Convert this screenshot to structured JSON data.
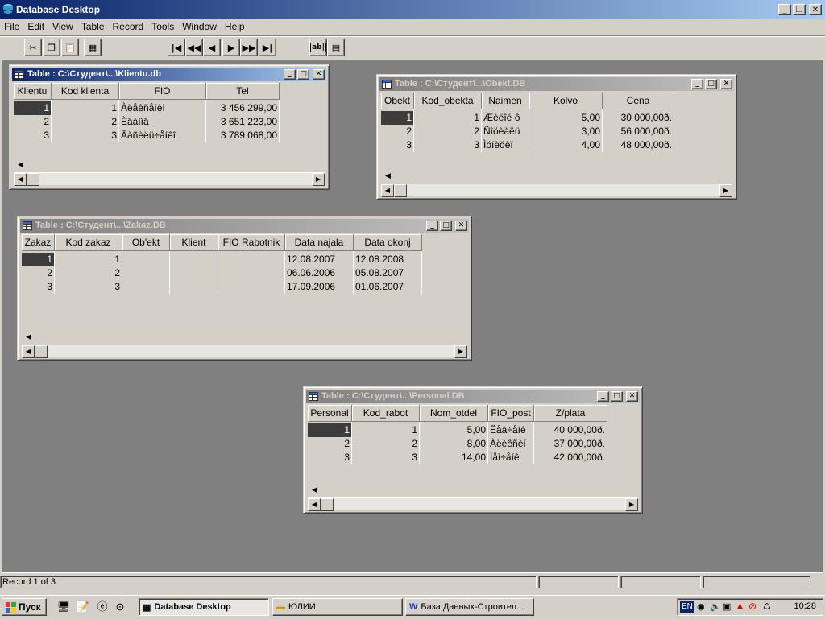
{
  "app": {
    "title": "Database Desktop"
  },
  "menu": [
    "File",
    "Edit",
    "View",
    "Table",
    "Record",
    "Tools",
    "Window",
    "Help"
  ],
  "toolbar": {
    "buttons": [
      "cut",
      "copy",
      "paste",
      "print",
      "first-record",
      "prev-set",
      "prev-record",
      "next-record",
      "next-set",
      "last-record",
      "edit-data",
      "restructure"
    ],
    "edit_label": "ab|"
  },
  "windows": {
    "klientu": {
      "title": "Table : C:\\Студент\\...\\Klientu.db",
      "columns": [
        "Klientu",
        "Kod klienta",
        "FIO",
        "Tel"
      ],
      "rows": [
        [
          "1",
          "1",
          "Àëåêñåíêî",
          "3 456 299,00"
        ],
        [
          "2",
          "2",
          "Èâàíîâ",
          "3 651 223,00"
        ],
        [
          "3",
          "3",
          "Âàñèëü÷åíêî",
          "3 789 068,00"
        ]
      ]
    },
    "obekt": {
      "title": "Table : C:\\Студент\\...\\Obekt.DB",
      "columns": [
        "Obekt",
        "Kod_obekta",
        "Naimen",
        "Kolvo",
        "Cena"
      ],
      "rows": [
        [
          "1",
          "1",
          "Æèëîé ô",
          "5,00",
          "30 000,00ð."
        ],
        [
          "2",
          "2",
          "Ñîöèàëü",
          "3,00",
          "56 000,00ð."
        ],
        [
          "3",
          "3",
          "Ìóíèöèï",
          "4,00",
          "48 000,00ð."
        ]
      ]
    },
    "zakaz": {
      "title": "Table : C:\\Студент\\...\\Zakaz.DB",
      "columns": [
        "Zakaz",
        "Kod zakaz",
        "Ob'ekt",
        "Klient",
        "FIO Rabotnik",
        "Data najala",
        "Data okonj"
      ],
      "rows": [
        [
          "1",
          "1",
          "",
          "",
          "",
          "12.08.2007",
          "12.08.2008"
        ],
        [
          "2",
          "2",
          "",
          "",
          "",
          "06.06.2006",
          "05.08.2007"
        ],
        [
          "3",
          "3",
          "",
          "",
          "",
          "17.09.2006",
          "01.06.2007"
        ]
      ]
    },
    "personal": {
      "title": "Table : C:\\Студент\\...\\Personal.DB",
      "columns": [
        "Personal",
        "Kod_rabot",
        "Nom_otdel",
        "FIO_post",
        "Z/plata"
      ],
      "rows": [
        [
          "1",
          "1",
          "5,00",
          "Ëåâ÷åíê",
          "40 000,00ð."
        ],
        [
          "2",
          "2",
          "8,00",
          "Àëèêñèí",
          "37 000,00ð."
        ],
        [
          "3",
          "3",
          "14,00",
          "Ìåì÷åíê",
          "42 000,00ð."
        ]
      ]
    }
  },
  "status": {
    "record": "Record 1 of 3"
  },
  "taskbar": {
    "start": "Пуск",
    "tasks": [
      "Database Desktop",
      "ЮЛИИ",
      "База Данных-Строител..."
    ],
    "lang": "EN",
    "clock": "10:28"
  },
  "colors": {
    "title_active": "#0a246a",
    "title_inactive": "#808080",
    "desktop": "#808080",
    "face": "#d4d0c8",
    "selection": "#3c3c3c"
  }
}
